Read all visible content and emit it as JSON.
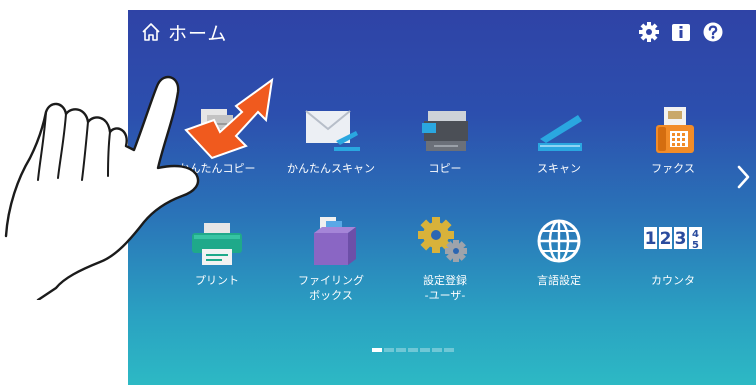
{
  "header": {
    "title": "ホーム",
    "icons": [
      "home-icon",
      "settings-icon",
      "info-icon",
      "help-icon"
    ]
  },
  "apps": {
    "row1": [
      {
        "label": "かんたんコピー",
        "icon": "easy-copy-icon"
      },
      {
        "label": "かんたんスキャン",
        "icon": "easy-scan-icon"
      },
      {
        "label": "コピー",
        "icon": "copy-icon"
      },
      {
        "label": "スキャン",
        "icon": "scan-icon"
      },
      {
        "label": "ファクス",
        "icon": "fax-icon"
      }
    ],
    "row2": [
      {
        "label": "プリント",
        "icon": "print-icon"
      },
      {
        "label": "ファイリング\nボックス",
        "icon": "filing-box-icon"
      },
      {
        "label": "設定登録\n-ユーザ-",
        "icon": "settings-register-icon"
      },
      {
        "label": "言語設定",
        "icon": "language-icon"
      },
      {
        "label": "カウンタ",
        "icon": "counter-icon"
      }
    ]
  },
  "counter_digits": [
    "1",
    "2",
    "3",
    "4",
    "5"
  ],
  "pager": {
    "pages": 7,
    "current": 1
  },
  "colors": {
    "accent": "#2aa7e0",
    "gesture_arrow": "#f05a1e",
    "screen_top": "#2f43a6",
    "screen_bottom": "#2db9c4"
  }
}
